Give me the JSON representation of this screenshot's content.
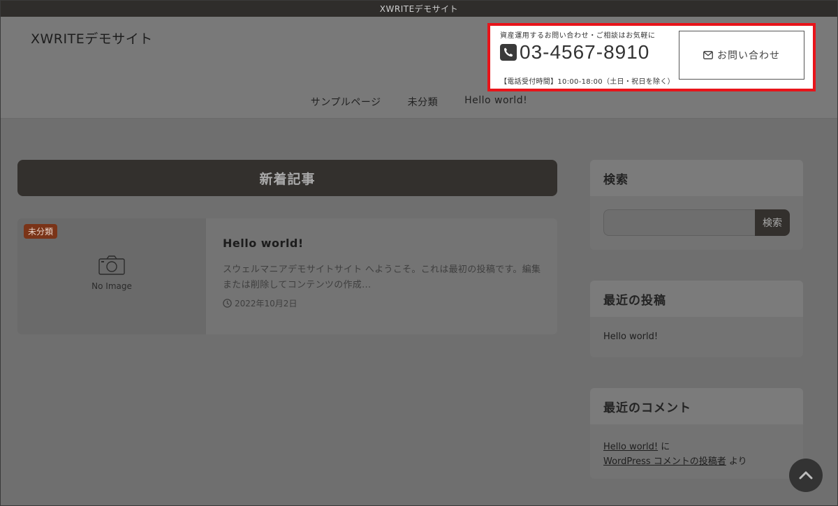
{
  "topbar": {
    "text": "XWRITEデモサイト"
  },
  "header": {
    "site_title": "XWRITEデモサイト",
    "contact": {
      "lead": "資産運用するお問い合わせ・ご相談はお気軽に",
      "phone": "03-4567-8910",
      "hours": "【電話受付時間】10:00-18:00（土日・祝日を除く）",
      "button_label": "お問い合わせ",
      "highlight_color": "#e8141a"
    },
    "nav": [
      "サンプルページ",
      "未分類",
      "Hello world!"
    ]
  },
  "main": {
    "heading": "新着記事",
    "post": {
      "category": "未分類",
      "no_image": "No Image",
      "title": "Hello world!",
      "excerpt": "スウェルマニアデモサイトサイト へようこそ。これは最初の投稿です。編集または削除してコンテンツの作成...",
      "date": "2022年10月2日"
    }
  },
  "sidebar": {
    "search": {
      "title": "検索",
      "button": "検索"
    },
    "recent_posts": {
      "title": "最近の投稿",
      "items": [
        "Hello world!"
      ]
    },
    "recent_comments": {
      "title": "最近のコメント",
      "post_link": "Hello world!",
      "post_suffix": " に",
      "author_link": "WordPress コメントの投稿者",
      "author_suffix": " より"
    }
  },
  "icons": {
    "phone": "phone-icon",
    "mail": "mail-icon",
    "camera": "camera-icon",
    "clock": "clock-icon",
    "scroll_top": "chevron-up-icon"
  }
}
